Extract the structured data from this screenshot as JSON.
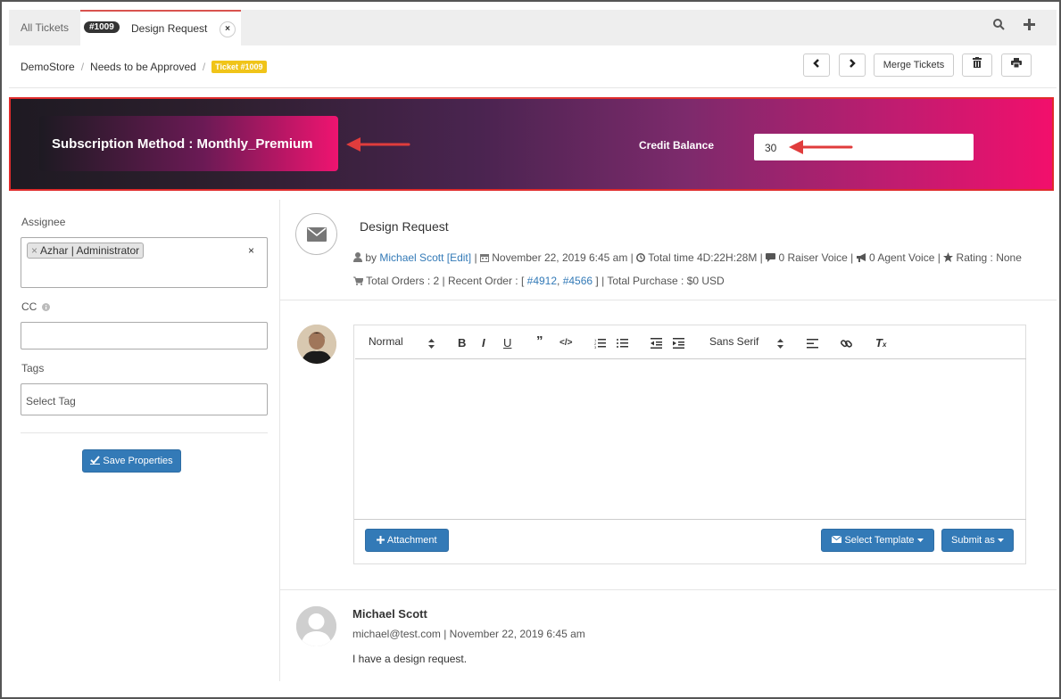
{
  "tabs": {
    "all_tickets": "All Tickets",
    "active_badge": "#1009",
    "active_title": "Design Request",
    "close": "×"
  },
  "toolbar_icons": {
    "search": "search-icon",
    "add": "plus-icon"
  },
  "breadcrumb": {
    "store": "DemoStore",
    "status": "Needs to be Approved",
    "ticket_badge": "Ticket #1009"
  },
  "actions": {
    "prev": "‹",
    "next": "›",
    "merge": "Merge Tickets"
  },
  "banner": {
    "subscription": "Subscription Method : Monthly_Premium",
    "credit_label": "Credit Balance",
    "credit_value": "30",
    "accent": "#e02b2b",
    "arrow_color": "#e03c3c"
  },
  "properties": {
    "assignee_label": "Assignee",
    "assignee_chip": "Azhar | Administrator",
    "assignee_clear": "×",
    "cc_label": "CC",
    "tags_label": "Tags",
    "tags_placeholder": "Select Tag",
    "save_button": "Save Properties"
  },
  "ticket": {
    "title": "Design Request",
    "by_prefix": "by",
    "author": "Michael Scott",
    "edit": "[Edit]",
    "date": "November 22, 2019 6:45 am",
    "total_time": "Total time 4D:22H:28M",
    "raiser_voice": "0 Raiser Voice",
    "agent_voice": "0 Agent Voice",
    "rating": "Rating : None",
    "total_orders": "Total Orders : 2 | Recent Order : [",
    "order1": "#4912",
    "order2": "#4566",
    "purchase": "] | Total Purchase : $0 USD"
  },
  "editor": {
    "format": "Normal",
    "font": "Sans Serif",
    "attachment": "Attachment",
    "select_template": "Select Template",
    "submit_as": "Submit as"
  },
  "thread": [
    {
      "author": "Michael Scott",
      "meta": "michael@test.com | November 22, 2019 6:45 am",
      "message": "I have a design request."
    }
  ]
}
